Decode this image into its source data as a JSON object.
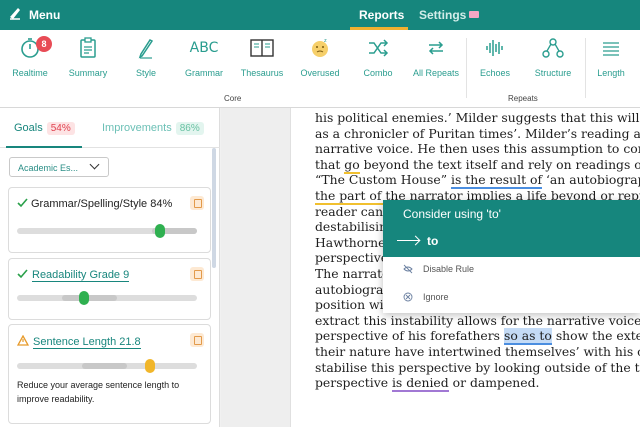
{
  "topbar": {
    "menu_label": "Menu",
    "tabs": [
      {
        "label": "Reports"
      },
      {
        "label": "Settings"
      }
    ]
  },
  "toolbar": {
    "tools": [
      {
        "label": "Realtime",
        "icon": "stopwatch-icon",
        "badge": "8"
      },
      {
        "label": "Summary",
        "icon": "clipboard-icon"
      },
      {
        "label": "Style",
        "icon": "pen-icon"
      },
      {
        "label": "Grammar",
        "icon": "abc-check-icon",
        "icon_text": "ABC"
      },
      {
        "label": "Thesaurus",
        "icon": "book-icon"
      },
      {
        "label": "Overused",
        "icon": "face-icon"
      },
      {
        "label": "Combo",
        "icon": "shuffle-icon"
      },
      {
        "label": "All Repeats",
        "icon": "repeat-icon"
      },
      {
        "label": "Echoes",
        "icon": "soundwave-icon"
      },
      {
        "label": "Structure",
        "icon": "network-icon"
      },
      {
        "label": "Length",
        "icon": "ruler-icon"
      }
    ],
    "groups": [
      {
        "label": "Core"
      },
      {
        "label": "Repeats"
      }
    ]
  },
  "left_panel": {
    "tabs": [
      {
        "label": "Goals",
        "value": "54%"
      },
      {
        "label": "Improvements",
        "value": "86%"
      }
    ],
    "document_type": "Academic Es...",
    "cards": [
      {
        "title": "Grammar/Spelling/Style 84%",
        "status": "check",
        "level": 0.84
      },
      {
        "title": "Readability Grade 9",
        "status": "check",
        "level": 0.38
      },
      {
        "title": "Sentence Length 21.8",
        "status": "warning",
        "level": 0.75,
        "description": "Reduce your average sentence length to improve readability."
      }
    ]
  },
  "document": {
    "lines": [
      [
        "his political enemies.’ Milder suggests that this will "
      ],
      [
        "as a chronicler of Puritan times’. Milder’s reading as"
      ],
      [
        "narrative voice. He then uses this assumption to con"
      ],
      [
        "that ",
        {
          "text": "go",
          "mark": "ul-y"
        },
        " beyond the text itself and rely on readings o"
      ],
      [
        "“The Custom House” ",
        {
          "text": "is the result of",
          "mark": "ul-b"
        },
        " ‘an autobiograp"
      ],
      [
        {
          "text": "the part of the narrator implies a life beyond or repr",
          "mark": "ul-y"
        }
      ],
      [
        "reader can"
      ],
      [
        "destabilisin"
      ],
      [
        "Hawthorne"
      ],
      [
        "perspective"
      ],
      [
        "The narrato"
      ],
      [
        "autobiogra"
      ],
      [
        "position wi"
      ],
      [
        "extract this instability allows for the narrative voice"
      ],
      [
        "perspective of his forefathers ",
        {
          "text": "so as to",
          "mark": "hl-b"
        },
        " show the exte"
      ],
      [
        "their nature have intertwined themselves’ with his o"
      ],
      [
        "stabilise this perspective by looking outside of the te"
      ],
      [
        "perspective ",
        {
          "text": "is denied",
          "mark": "ul-p"
        },
        " or dampened."
      ]
    ]
  },
  "popup": {
    "title": "Consider using 'to'",
    "suggestion": "to",
    "actions": [
      {
        "label": "Disable Rule",
        "icon": "eye-off-icon"
      },
      {
        "label": "Ignore",
        "icon": "x-circle-icon"
      }
    ]
  }
}
